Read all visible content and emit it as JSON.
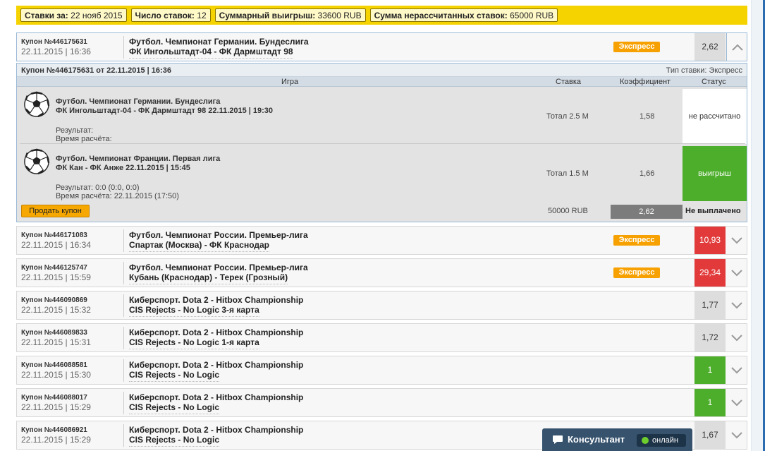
{
  "summary": {
    "bets_for_label": "Ставки за:",
    "bets_for_value": "22 нояб 2015",
    "count_label": "Число ставок:",
    "count_value": "12",
    "total_win_label": "Суммарный выигрыш:",
    "total_win_value": "33600 RUB",
    "unsettled_label": "Сумма нерассчитанных ставок:",
    "unsettled_value": "65000 RUB"
  },
  "coupons": [
    {
      "id": "Купон №446175631",
      "date": "22.11.2015 | 16:36",
      "league": "Футбол. Чемпионат Германии. Бундеслига",
      "teams": "ФК Ингольштадт-04 - ФК Дармштадт 98",
      "badge": "Экспресс",
      "coef": "2,62",
      "coef_style": "grey",
      "expanded": true
    },
    {
      "id": "Купон №446171083",
      "date": "22.11.2015 | 16:34",
      "league": "Футбол. Чемпионат России. Премьер-лига",
      "teams": "Спартак (Москва) - ФК Краснодар",
      "badge": "Экспресс",
      "coef": "10,93",
      "coef_style": "red",
      "expanded": false
    },
    {
      "id": "Купон №446125747",
      "date": "22.11.2015 | 15:59",
      "league": "Футбол. Чемпионат России. Премьер-лига",
      "teams": "Кубань (Краснодар) - Терек (Грозный)",
      "badge": "Экспресс",
      "coef": "29,34",
      "coef_style": "red",
      "expanded": false
    },
    {
      "id": "Купон №446090869",
      "date": "22.11.2015 | 15:32",
      "league": "Киберспорт. Dota 2 - Hitbox Championship",
      "teams": "CIS Rejects - No Logic 3-я карта",
      "badge": "",
      "coef": "1,77",
      "coef_style": "grey",
      "expanded": false
    },
    {
      "id": "Купон №446089833",
      "date": "22.11.2015 | 15:31",
      "league": "Киберспорт. Dota 2 - Hitbox Championship",
      "teams": "CIS Rejects - No Logic 1-я карта",
      "badge": "",
      "coef": "1,72",
      "coef_style": "grey",
      "expanded": false
    },
    {
      "id": "Купон №446088581",
      "date": "22.11.2015 | 15:30",
      "league": "Киберспорт. Dota 2 - Hitbox Championship",
      "teams": "CIS Rejects - No Logic",
      "badge": "",
      "coef": "1",
      "coef_style": "green",
      "expanded": false
    },
    {
      "id": "Купон №446088017",
      "date": "22.11.2015 | 15:29",
      "league": "Киберспорт. Dota 2 - Hitbox Championship",
      "teams": "CIS Rejects - No Logic",
      "badge": "",
      "coef": "1",
      "coef_style": "green",
      "expanded": false
    },
    {
      "id": "Купон №446086921",
      "date": "22.11.2015 | 15:29",
      "league": "Киберспорт. Dota 2 - Hitbox Championship",
      "teams": "CIS Rejects - No Logic",
      "badge": "",
      "coef": "1,67",
      "coef_style": "grey",
      "expanded": false
    }
  ],
  "detail": {
    "title": "Купон №446175631 от 22.11.2015 | 16:36",
    "bet_type": "Тип ставки: Экспресс",
    "columns": {
      "game": "Игра",
      "stake": "Ставка",
      "coef": "Коэффициент",
      "status": "Статус"
    },
    "bets": [
      {
        "league": "Футбол. Чемпионат Германии. Бундеслига",
        "match": "ФК Ингольштадт-04 - ФК Дармштадт 98 22.11.2015 | 19:30",
        "result": "Результат:",
        "calc_time": "Время расчёта:",
        "stake": "Тотал 2.5 М",
        "coef": "1,58",
        "status": "не рассчитано",
        "status_style": "white"
      },
      {
        "league": "Футбол. Чемпионат Франции. Первая лига",
        "match": "ФК Кан - ФК Анже 22.11.2015 | 15:45",
        "result": "Результат: 0:0 (0:0, 0:0)",
        "calc_time": "Время расчёта: 22.11.2015 (17:50)",
        "stake": "Тотал 1.5 М",
        "coef": "1,66",
        "status": "выигрыш",
        "status_style": "win"
      }
    ],
    "sell_button": "Продать купон",
    "sum": "50000 RUB",
    "total_coef": "2,62",
    "payout_status": "Не выплачено"
  },
  "consultant": {
    "label": "Консультант",
    "status": "онлайн"
  },
  "colors": {
    "summary_bg": "#f5d300",
    "express": "#f7a100",
    "red_coef": "#e23a3a",
    "green_coef": "#4cae2b",
    "consultant_bg": "#36526d"
  }
}
